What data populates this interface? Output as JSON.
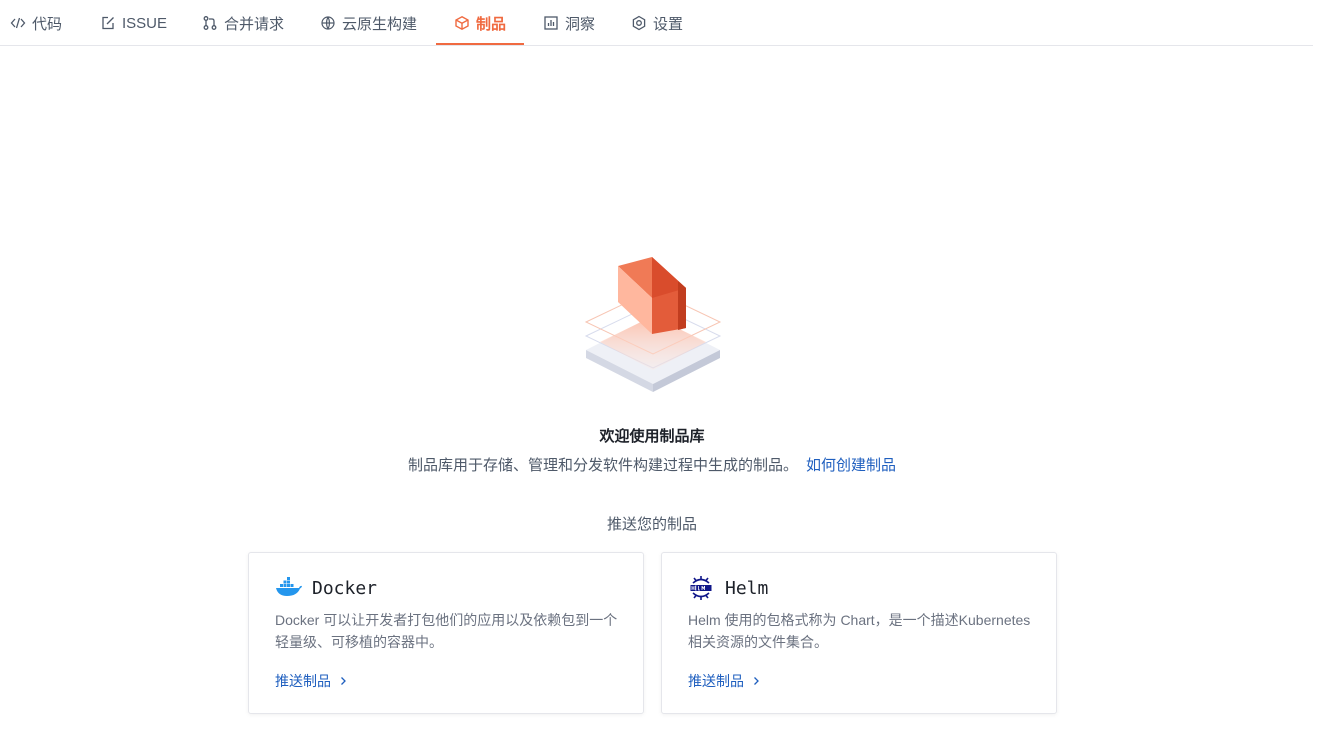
{
  "tabs": [
    {
      "label": "代码",
      "icon": "code-icon"
    },
    {
      "label": "ISSUE",
      "icon": "edit-icon"
    },
    {
      "label": "合并请求",
      "icon": "merge-request-icon"
    },
    {
      "label": "云原生构建",
      "icon": "build-icon"
    },
    {
      "label": "制品",
      "icon": "package-icon",
      "active": true
    },
    {
      "label": "洞察",
      "icon": "chart-icon"
    },
    {
      "label": "设置",
      "icon": "gear-icon"
    }
  ],
  "welcome": {
    "title": "欢迎使用制品库",
    "description": "制品库用于存储、管理和分发软件构建过程中生成的制品。",
    "link": "如何创建制品"
  },
  "push_heading": "推送您的制品",
  "cards": [
    {
      "name": "Docker",
      "icon": "docker-icon",
      "description": "Docker 可以让开发者打包他们的应用以及依赖包到一个轻量级、可移植的容器中。",
      "link": "推送制品"
    },
    {
      "name": "Helm",
      "icon": "helm-icon",
      "description": "Helm 使用的包格式称为 Chart，是一个描述Kubernetes相关资源的文件集合。",
      "link": "推送制品"
    }
  ],
  "colors": {
    "accent": "#f06a40",
    "link": "#1f5fbf"
  }
}
